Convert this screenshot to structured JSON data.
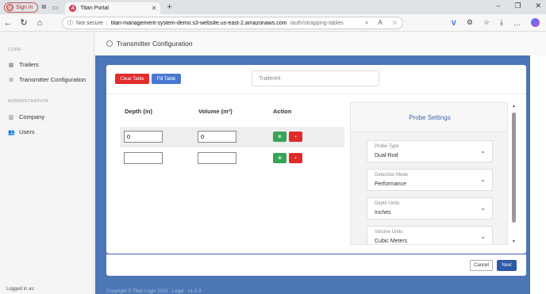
{
  "browser": {
    "signin_label": "Sign in",
    "tab_title": "Titan Portal",
    "url_security": "Not secure",
    "url_host": "titan-management-system-demo.s3-website.us-east-2.amazonaws.com",
    "url_path": "/auth/strapping-tables"
  },
  "sidebar": {
    "section_core": "CORE",
    "items_core": [
      {
        "label": "Trailers"
      },
      {
        "label": "Transmitter Configuration"
      }
    ],
    "section_admin": "ADMINISTRATION",
    "items_admin": [
      {
        "label": "Company"
      },
      {
        "label": "Users"
      }
    ],
    "logged_in": "Logged in as:"
  },
  "page": {
    "title": "Transmitter Configuration"
  },
  "toolbar": {
    "clear_label": "Clear Table",
    "fill_label": "Fill Table",
    "trailer_value": "Trailer#4"
  },
  "table": {
    "headers": [
      "Depth (in)",
      "Volume (m³)",
      "Action"
    ],
    "rows": [
      {
        "depth": "0",
        "volume": "0"
      },
      {
        "depth": "",
        "volume": ""
      }
    ]
  },
  "probe": {
    "title": "Probe Settings",
    "fields": [
      {
        "label": "Probe Type",
        "value": "Dual-Rod"
      },
      {
        "label": "Detection Mode",
        "value": "Performance"
      },
      {
        "label": "Depth Units",
        "value": "Inches"
      },
      {
        "label": "Volume Units",
        "value": "Cubic Meters"
      }
    ]
  },
  "footer": {
    "cancel_label": "Cancel",
    "next_label": "Next",
    "copyright": "Copyright © Titan Logix 2023 · Legal · v1.0.0"
  },
  "colors": {
    "accent_blue": "#4d76b7",
    "danger": "#e02b2b",
    "success": "#36a45a"
  }
}
